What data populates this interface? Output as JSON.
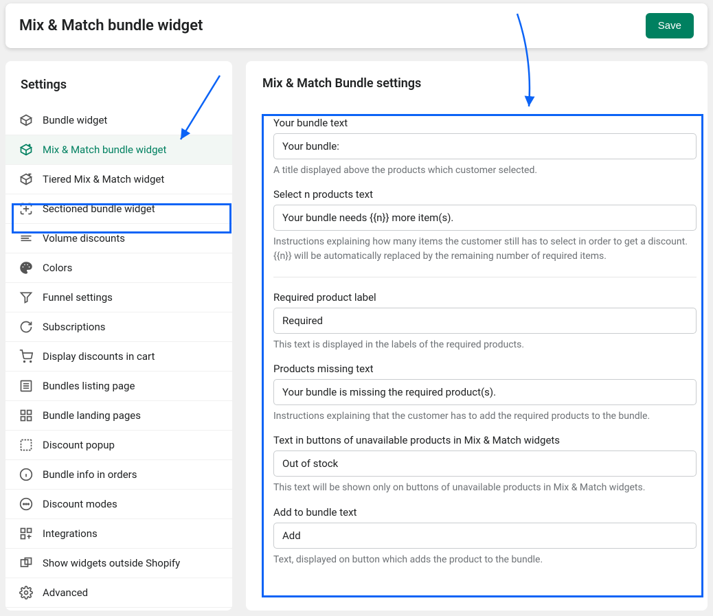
{
  "header": {
    "title": "Mix & Match bundle widget",
    "save_label": "Save"
  },
  "sidebar": {
    "title": "Settings",
    "items": [
      {
        "label": "Bundle widget"
      },
      {
        "label": "Mix & Match bundle widget"
      },
      {
        "label": "Tiered Mix & Match widget"
      },
      {
        "label": "Sectioned bundle widget"
      },
      {
        "label": "Volume discounts"
      },
      {
        "label": "Colors"
      },
      {
        "label": "Funnel settings"
      },
      {
        "label": "Subscriptions"
      },
      {
        "label": "Display discounts in cart"
      },
      {
        "label": "Bundles listing page"
      },
      {
        "label": "Bundle landing pages"
      },
      {
        "label": "Discount popup"
      },
      {
        "label": "Bundle info in orders"
      },
      {
        "label": "Discount modes"
      },
      {
        "label": "Integrations"
      },
      {
        "label": "Show widgets outside Shopify"
      },
      {
        "label": "Advanced"
      }
    ]
  },
  "main": {
    "title": "Mix & Match Bundle settings",
    "fields": [
      {
        "label": "Your bundle text",
        "value": "Your bundle:",
        "help": "A title displayed above the products which customer selected."
      },
      {
        "label": "Select n products text",
        "value": "Your bundle needs {{n}} more item(s).",
        "help": "Instructions explaining how many items the customer still has to select in order to get a discount. {{n}} will be automatically replaced by the remaining number of required items."
      },
      {
        "label": "Required product label",
        "value": "Required",
        "help": "This text is displayed in the labels of the required products."
      },
      {
        "label": "Products missing text",
        "value": "Your bundle is missing the required product(s).",
        "help": "Instructions explaining that the customer has to add the required products to the bundle."
      },
      {
        "label": "Text in buttons of unavailable products in Mix & Match widgets",
        "value": "Out of stock",
        "help": "This text will be shown only on buttons of unavailable products in Mix & Match widgets."
      },
      {
        "label": "Add to bundle text",
        "value": "Add",
        "help": "Text, displayed on button which adds the product to the bundle."
      }
    ]
  }
}
